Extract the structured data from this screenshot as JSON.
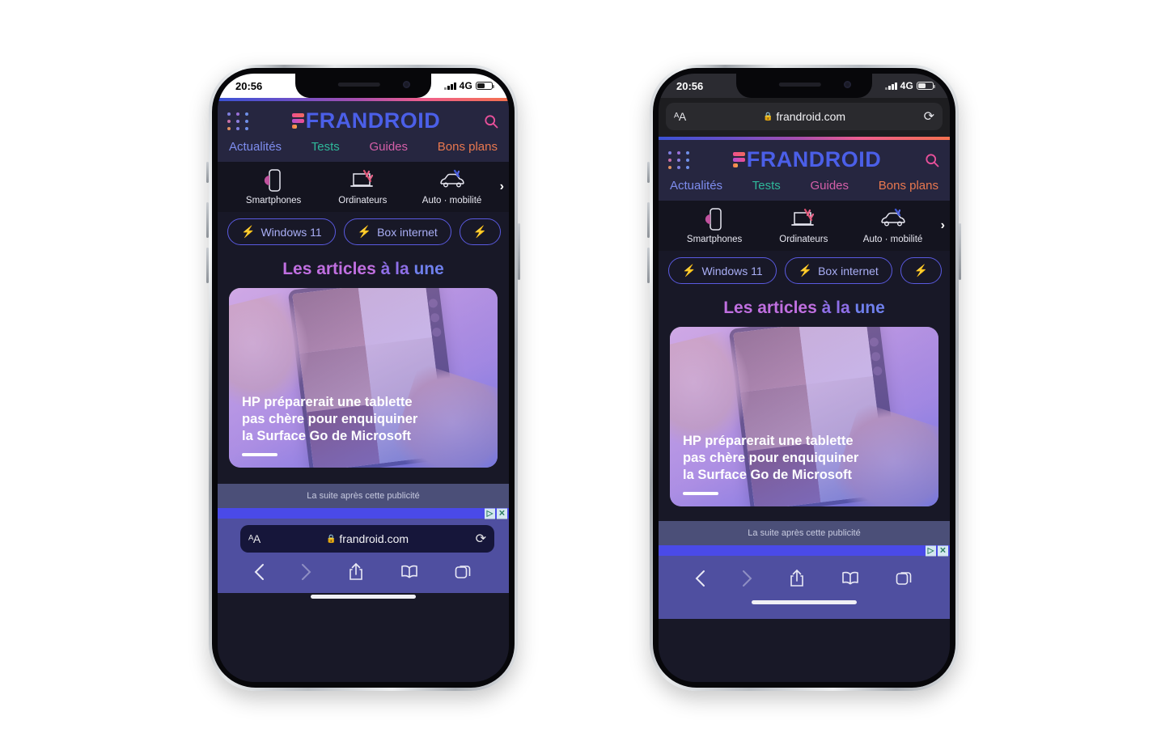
{
  "meta": {
    "background": "#ffffff",
    "device": "iphone-12",
    "accent_blue": "#4b5fe8",
    "accent_pink": "#e8509a"
  },
  "status": {
    "time": "20:56",
    "network": "4G",
    "signal_icon": "cellular-bars-icon",
    "battery_icon": "battery-icon"
  },
  "browser": {
    "aa_label": "AA",
    "lock_icon": "lock-icon",
    "url": "frandroid.com",
    "reload_icon": "reload-icon",
    "toolbar": {
      "back_icon": "chevron-left-icon",
      "forward_icon": "chevron-right-icon",
      "share_icon": "share-icon",
      "bookmarks_icon": "book-icon",
      "tabs_icon": "tabs-icon"
    }
  },
  "site": {
    "menu_icon": "grid-dots-icon",
    "logo_mark": "frandroid-f-icon",
    "logo_text": "FRANDROID",
    "search_icon": "search-icon",
    "nav": [
      {
        "label": "Actualités",
        "color": "#7e8dee"
      },
      {
        "label": "Tests",
        "color": "#2fb89a"
      },
      {
        "label": "Guides",
        "color": "#d croix"
      },
      {
        "label": "Bons plans",
        "color": "#e9784f"
      }
    ],
    "nav_colors": [
      "#7e8dee",
      "#2fb89a",
      "#d45fa8",
      "#e9784f"
    ],
    "categories": [
      {
        "label": "Smartphones",
        "icon": "smartphone-icon"
      },
      {
        "label": "Ordinateurs",
        "icon": "laptop-icon"
      },
      {
        "label": "Auto · mobilité",
        "icon": "car-icon"
      }
    ],
    "categories_next_icon": "chevron-right-icon",
    "chips": [
      {
        "label": "Windows 11",
        "icon": "bolt-icon"
      },
      {
        "label": "Box internet",
        "icon": "bolt-icon"
      },
      {
        "label": "",
        "icon": "bolt-icon"
      }
    ],
    "section_title": {
      "part1": "Les articles ",
      "part2": "à la ",
      "part3": "une"
    },
    "featured_article": {
      "title_line1": "HP préparerait une tablette",
      "title_line2": "pas chère pour enquiquiner",
      "title_line3": "la Surface Go de Microsoft"
    },
    "ad": {
      "label": "La suite après cette publicité",
      "adchoices_icon": "adchoices-icon",
      "close_icon": "close-icon",
      "adchoices_glyph": "▷",
      "close_glyph": "✕"
    }
  }
}
